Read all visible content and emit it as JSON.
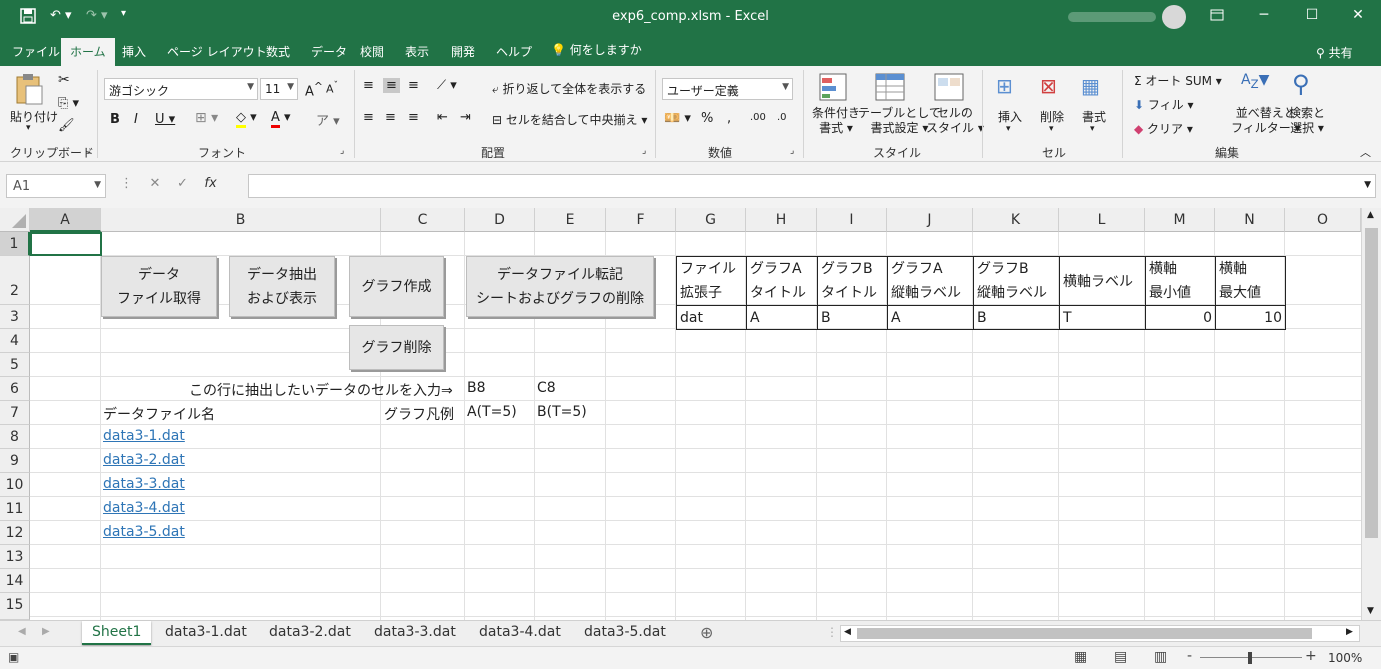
{
  "app": {
    "title": "exp6_comp.xlsm  -  Excel"
  },
  "tabs": {
    "file": "ファイル",
    "home": "ホーム",
    "insert": "挿入",
    "pagelayout": "ページ レイアウト",
    "formulas": "数式",
    "data": "データ",
    "review": "校閲",
    "view": "表示",
    "developer": "開発",
    "help": "ヘルプ",
    "tellme": "何をしますか",
    "share": "共有"
  },
  "ribbon": {
    "paste": "貼り付け",
    "clipboard": "クリップボード",
    "font_name": "游ゴシック",
    "font_size": "11",
    "font": "フォント",
    "wrap": "折り返して全体を表示する",
    "merge": "セルを結合して中央揃え",
    "alignment": "配置",
    "numfmt": "ユーザー定義",
    "number": "数値",
    "cond1": "条件付き",
    "cond2": "書式",
    "table1": "テーブルとして",
    "table2": "書式設定",
    "cellstyle1": "セルの",
    "cellstyle2": "スタイル",
    "styles": "スタイル",
    "insert": "挿入",
    "delete": "削除",
    "format": "書式",
    "cells": "セル",
    "autosum": "オート SUM",
    "fill": "フィル",
    "clear": "クリア",
    "sort1": "並べ替えと",
    "sort2": "フィルター",
    "find1": "検索と",
    "find2": "選択",
    "editing": "編集"
  },
  "namebox": "A1",
  "columns": [
    "A",
    "B",
    "C",
    "D",
    "E",
    "F",
    "G",
    "H",
    "I",
    "J",
    "K",
    "L",
    "M",
    "N",
    "O"
  ],
  "rows": [
    "1",
    "2",
    "3",
    "4",
    "5",
    "6",
    "7",
    "8",
    "9",
    "10",
    "11",
    "12",
    "13",
    "14",
    "15"
  ],
  "buttons": {
    "b1": "データ\nファイル取得",
    "b2": "データ抽出\nおよび表示",
    "b3": "グラフ作成",
    "b4": "データファイル転記\nシートおよびグラフの削除",
    "b5": "グラフ削除"
  },
  "cells": {
    "instr": "この行に抽出したいデータのセルを入力⇒",
    "d6": "B8",
    "e6": "C8",
    "b7": "データファイル名",
    "c7": "グラフ凡例",
    "d7": "A(T=5)",
    "e7": "B(T=5)",
    "files": [
      "data3-1.dat",
      "data3-2.dat",
      "data3-3.dat",
      "data3-4.dat",
      "data3-5.dat"
    ]
  },
  "table": {
    "h1": [
      "ファイル",
      "グラフA",
      "グラフB",
      "グラフA",
      "グラフB",
      "",
      "横軸",
      "横軸"
    ],
    "h2": [
      "拡張子",
      "タイトル",
      "タイトル",
      "縦軸ラベル",
      "縦軸ラベル",
      "横軸ラベル",
      "最小値",
      "最大値"
    ],
    "vals": [
      "dat",
      "A",
      "B",
      "A",
      "B",
      "T",
      "0",
      "10"
    ]
  },
  "sheets": [
    "Sheet1",
    "data3-1.dat",
    "data3-2.dat",
    "data3-3.dat",
    "data3-4.dat",
    "data3-5.dat"
  ],
  "zoom": "100%"
}
